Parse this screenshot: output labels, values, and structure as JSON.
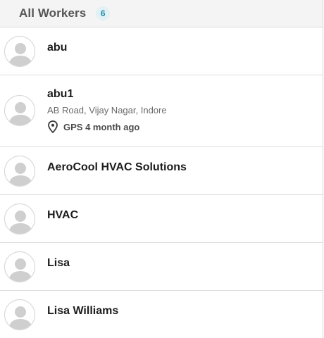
{
  "header": {
    "title": "All Workers",
    "count": "6"
  },
  "workers": [
    {
      "name": "abu"
    },
    {
      "name": "abu1",
      "address": "AB Road, Vijay Nagar, Indore",
      "gps": "GPS 4 month ago"
    },
    {
      "name": "AeroCool HVAC Solutions"
    },
    {
      "name": "HVAC"
    },
    {
      "name": "Lisa"
    },
    {
      "name": "Lisa Williams"
    }
  ],
  "icons": {
    "avatar": "default-user-avatar-icon",
    "location": "map-pin-icon"
  },
  "colors": {
    "header_bg": "#f4f4f4",
    "count_badge_bg": "#e3f1f4",
    "count_badge_text": "#1e8ea8",
    "avatar_fill": "#cfcfcf"
  }
}
